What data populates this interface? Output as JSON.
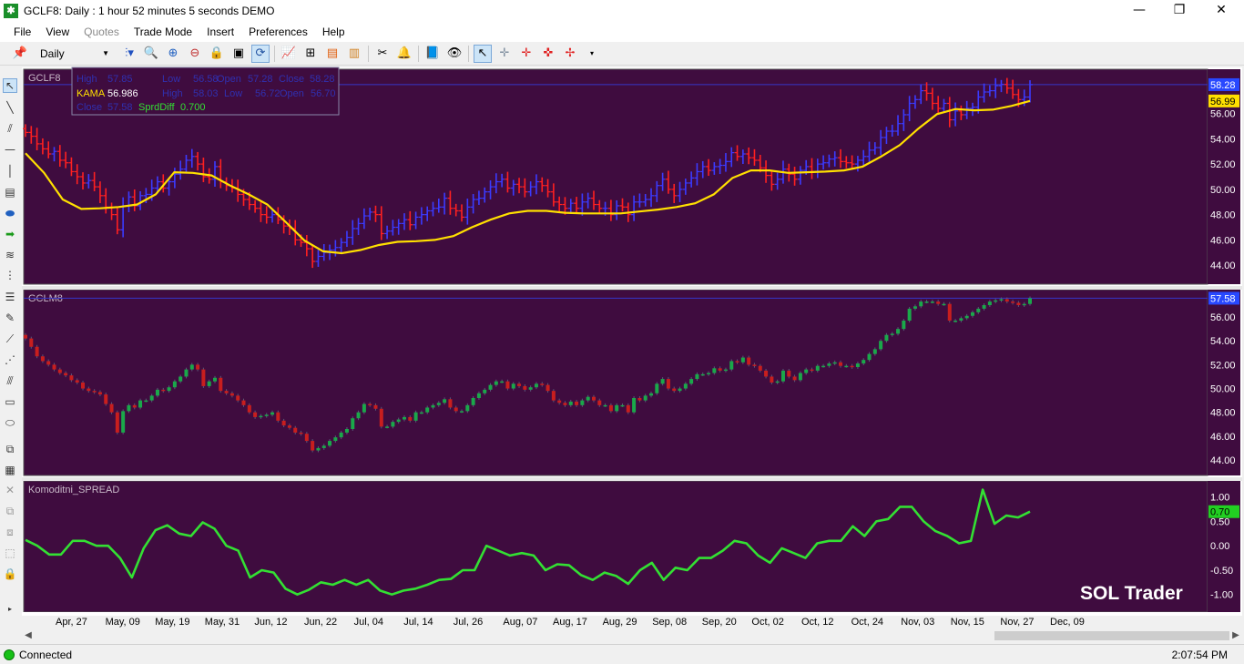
{
  "window": {
    "title": "GCLF8: Daily : 1 hour 52 minutes 5 seconds DEMO",
    "minimize": "—",
    "maximize": "❐",
    "close": "✕"
  },
  "menu": {
    "items": [
      {
        "label": "File",
        "enabled": true
      },
      {
        "label": "View",
        "enabled": true
      },
      {
        "label": "Quotes",
        "enabled": false
      },
      {
        "label": "Trade Mode",
        "enabled": true
      },
      {
        "label": "Insert",
        "enabled": true
      },
      {
        "label": "Preferences",
        "enabled": true
      },
      {
        "label": "Help",
        "enabled": true
      }
    ]
  },
  "toolbar": {
    "period": "Daily",
    "icons": [
      "pin-icon",
      "bar-style-icon",
      "zoom-icon",
      "zoom-in-icon",
      "zoom-out-icon",
      "lock-icon",
      "fit-icon",
      "draw-mode-icon",
      "indicator-icon",
      "tree-icon",
      "bar-color-icon",
      "bar-chart-icon",
      "tools-icon",
      "bell-icon",
      "book-icon",
      "eye-icon",
      "pointer-icon",
      "crosshair-icon",
      "crosshair-red-icon",
      "crosshair-red2-icon",
      "overflow-icon"
    ]
  },
  "chart_data": [
    {
      "type": "ohlc",
      "title": "GCLF8",
      "price_label": "58.28",
      "indicator_label": "56.99",
      "ylim": [
        42.5,
        59.5
      ],
      "yticks": [
        "56.00",
        "54.00",
        "52.00",
        "50.00",
        "48.00",
        "46.00",
        "44.00"
      ],
      "overlay": {
        "name": "KAMA",
        "color": "#ffe000"
      },
      "legend": [
        {
          "label": "High",
          "value": "57.85"
        },
        {
          "label": "Low",
          "value": "56.58"
        },
        {
          "label": "Open",
          "value": "57.28"
        },
        {
          "label": "Close",
          "value": "58.28"
        },
        {
          "label": "KAMA",
          "value": "56.986"
        },
        {
          "label": "High",
          "value": "58.03"
        },
        {
          "label": "Low",
          "value": "56.72"
        },
        {
          "label": "Open",
          "value": "56.70"
        },
        {
          "label": "Close",
          "value": "57.58"
        },
        {
          "label": "SprdDiff",
          "value": "0.700"
        }
      ],
      "closes": [
        54.5,
        54.2,
        53.6,
        53.2,
        52.8,
        53.0,
        52.3,
        52.1,
        51.4,
        51.0,
        50.5,
        50.7,
        50.2,
        49.5,
        48.6,
        48.0,
        46.8,
        48.7,
        49.4,
        48.7,
        49.5,
        49.6,
        50.1,
        50.6,
        50.1,
        50.6,
        51.2,
        51.6,
        52.3,
        52.6,
        52.0,
        51.0,
        50.8,
        51.8,
        50.6,
        50.3,
        50.1,
        49.6,
        49.2,
        48.8,
        48.5,
        48.0,
        47.8,
        48.0,
        47.6,
        47.1,
        46.9,
        46.0,
        45.8,
        45.3,
        44.3,
        44.7,
        45.0,
        45.2,
        45.4,
        45.8,
        46.2,
        46.9,
        47.3,
        47.9,
        48.2,
        48.0,
        46.5,
        46.7,
        47.0,
        47.3,
        47.6,
        47.2,
        47.8,
        48.0,
        48.3,
        48.5,
        48.6,
        49.3,
        48.5,
        48.3,
        47.8,
        48.6,
        49.2,
        49.3,
        49.8,
        50.2,
        50.6,
        50.8,
        50.1,
        50.4,
        50.2,
        49.8,
        50.2,
        50.6,
        50.3,
        49.8,
        49.0,
        48.8,
        48.5,
        48.9,
        48.5,
        49.0,
        49.3,
        48.8,
        48.5,
        48.5,
        48.0,
        48.7,
        48.6,
        48.0,
        49.0,
        49.0,
        49.2,
        49.5,
        50.3,
        50.8,
        50.0,
        49.5,
        50.0,
        50.5,
        50.9,
        51.4,
        51.8,
        51.5,
        51.8,
        51.9,
        52.2,
        52.9,
        52.6,
        52.8,
        52.5,
        52.3,
        51.7,
        51.1,
        50.4,
        50.8,
        51.6,
        51.2,
        50.8,
        51.5,
        51.8,
        51.4,
        52.0,
        52.1,
        52.4,
        52.5,
        52.2,
        52.1,
        52.0,
        52.3,
        52.6,
        53.1,
        53.3,
        54.1,
        54.6,
        54.6,
        55.2,
        55.9,
        56.8,
        57.1,
        57.8,
        57.6,
        56.8,
        56.4,
        56.8,
        55.5,
        56.2,
        55.9,
        56.4,
        56.5,
        57.3,
        57.7,
        57.8,
        58.2,
        58.3,
        58.0,
        57.5,
        57.1,
        57.3,
        58.28
      ],
      "kama": [
        52.85,
        51.3,
        49.2,
        48.45,
        48.5,
        48.6,
        48.8,
        49.6,
        51.35,
        51.3,
        51.1,
        50.3,
        49.6,
        48.8,
        47.4,
        45.95,
        45.1,
        44.95,
        45.2,
        45.6,
        45.85,
        45.9,
        46.0,
        46.3,
        47.0,
        47.6,
        48.1,
        48.3,
        48.3,
        48.15,
        48.1,
        48.1,
        48.1,
        48.25,
        48.4,
        48.6,
        48.9,
        49.6,
        50.9,
        51.5,
        51.5,
        51.3,
        51.35,
        51.4,
        51.5,
        51.8,
        52.6,
        53.5,
        54.8,
        55.95,
        56.35,
        56.25,
        56.3,
        56.6,
        56.99
      ],
      "x_first": 4,
      "x_last": 1107
    },
    {
      "type": "ohlc",
      "title": "GCLM8",
      "price_label": "57.58",
      "ylim": [
        42.7,
        58.3
      ],
      "yticks": [
        "56.00",
        "54.00",
        "52.00",
        "50.00",
        "48.00",
        "46.00",
        "44.00"
      ],
      "closes": [
        54.2,
        53.5,
        52.7,
        52.3,
        52.0,
        51.6,
        51.3,
        51.1,
        50.7,
        50.5,
        50.0,
        49.8,
        49.7,
        49.5,
        48.7,
        48.0,
        46.3,
        48.1,
        48.6,
        48.4,
        49.0,
        49.0,
        49.4,
        49.9,
        49.8,
        50.1,
        50.6,
        51.0,
        51.6,
        52.0,
        51.6,
        50.2,
        50.6,
        50.9,
        49.8,
        49.6,
        49.4,
        49.0,
        48.6,
        48.0,
        47.6,
        47.7,
        47.8,
        48.0,
        47.3,
        46.9,
        46.7,
        46.3,
        46.2,
        45.6,
        44.8,
        45.0,
        45.2,
        45.6,
        45.9,
        46.3,
        46.6,
        47.5,
        48.0,
        48.7,
        48.6,
        48.3,
        46.8,
        46.8,
        47.2,
        47.4,
        47.6,
        47.3,
        48.0,
        48.0,
        48.4,
        48.6,
        48.8,
        49.1,
        48.4,
        48.1,
        48.1,
        48.6,
        49.2,
        49.6,
        49.9,
        50.3,
        50.6,
        50.6,
        50.0,
        50.4,
        50.2,
        49.9,
        50.1,
        50.4,
        50.3,
        49.8,
        49.0,
        48.8,
        48.6,
        48.9,
        48.6,
        49.0,
        49.3,
        49.0,
        48.6,
        48.6,
        48.1,
        48.6,
        48.6,
        48.0,
        49.2,
        49.0,
        49.4,
        49.6,
        50.4,
        50.8,
        50.0,
        49.8,
        50.0,
        50.4,
        50.8,
        51.2,
        51.2,
        51.3,
        51.7,
        51.5,
        51.6,
        52.3,
        52.2,
        52.6,
        52.0,
        51.9,
        51.5,
        51.0,
        50.5,
        50.6,
        51.5,
        51.0,
        50.7,
        51.3,
        51.6,
        51.5,
        51.9,
        51.9,
        52.1,
        52.2,
        51.9,
        51.9,
        51.8,
        52.1,
        52.4,
        52.9,
        53.3,
        54.0,
        54.5,
        54.6,
        55.0,
        55.7,
        56.7,
        56.9,
        57.3,
        57.3,
        57.3,
        57.1,
        57.1,
        55.7,
        55.7,
        55.9,
        56.1,
        56.4,
        56.7,
        57.0,
        57.3,
        57.4,
        57.5,
        57.3,
        57.2,
        57.0,
        57.1,
        57.58
      ]
    },
    {
      "type": "line",
      "title": "Komoditni_SPREAD",
      "price_label": "0.70",
      "ylim": [
        -1.36,
        1.33
      ],
      "yticks": [
        "1.00",
        "0.50",
        "0.00",
        "-0.50",
        "-1.00"
      ],
      "series_color": "#33e033",
      "values": [
        0.12,
        0.0,
        -0.18,
        -0.18,
        0.1,
        0.1,
        0.0,
        0.0,
        -0.25,
        -0.65,
        -0.05,
        0.32,
        0.42,
        0.25,
        0.2,
        0.48,
        0.35,
        0.0,
        -0.1,
        -0.65,
        -0.5,
        -0.55,
        -0.88,
        -1.0,
        -0.9,
        -0.75,
        -0.8,
        -0.7,
        -0.8,
        -0.7,
        -0.92,
        -1.0,
        -0.92,
        -0.88,
        -0.8,
        -0.7,
        -0.68,
        -0.5,
        -0.5,
        0.0,
        -0.1,
        -0.2,
        -0.15,
        -0.2,
        -0.5,
        -0.38,
        -0.4,
        -0.6,
        -0.7,
        -0.55,
        -0.62,
        -0.78,
        -0.5,
        -0.35,
        -0.7,
        -0.45,
        -0.5,
        -0.25,
        -0.25,
        -0.1,
        0.1,
        0.05,
        -0.2,
        -0.35,
        -0.05,
        -0.15,
        -0.25,
        0.05,
        0.1,
        0.1,
        0.4,
        0.2,
        0.5,
        0.55,
        0.8,
        0.8,
        0.5,
        0.3,
        0.2,
        0.05,
        0.1,
        1.15,
        0.45,
        0.62,
        0.58,
        0.7
      ]
    }
  ],
  "x_axis": {
    "labels": [
      "Apr, 27",
      "May, 09",
      "May, 19",
      "May, 31",
      "Jun, 12",
      "Jun, 22",
      "Jul, 04",
      "Jul, 14",
      "Jul, 26",
      "Aug, 07",
      "Aug, 17",
      "Aug, 29",
      "Sep, 08",
      "Sep, 20",
      "Oct, 02",
      "Oct, 12",
      "Oct, 24",
      "Nov, 03",
      "Nov, 15",
      "Nov, 27",
      "Dec, 09"
    ]
  },
  "watermark": "SOL Trader",
  "status": {
    "connection": "Connected",
    "time": "2:07:54 PM"
  },
  "colors": {
    "background": "#3f0c3f",
    "up_bar": "#3b3bff",
    "down_bar": "#ff2020",
    "candle_up": "#1aa84a",
    "candle_down": "#c81e1e",
    "price_tag_bg": "#2848ff",
    "kama_tag_bg": "#ffe000",
    "spread_tag_bg": "#22d022"
  }
}
